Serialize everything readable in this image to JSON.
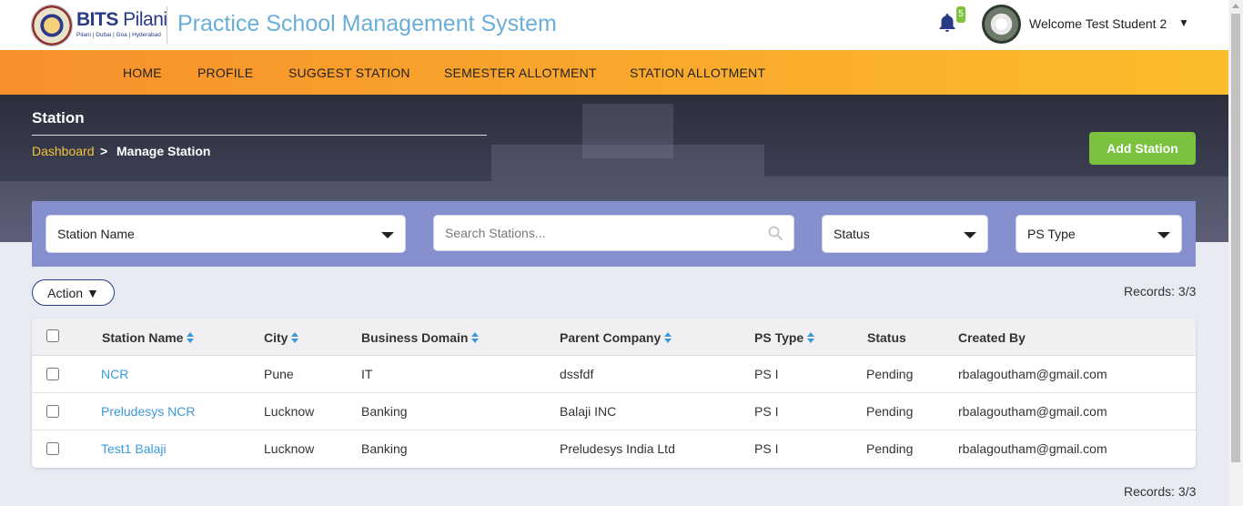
{
  "brand": {
    "name_bold": "BITS",
    "name_light": " Pilani",
    "subtitle": "Pilani | Dubai | Goa | Hyderabad"
  },
  "app_title": "Practice School Management System",
  "notifications": {
    "count": "5"
  },
  "user": {
    "welcome": "Welcome Test Student 2",
    "caret": "▼"
  },
  "nav": {
    "items": [
      "HOME",
      "PROFILE",
      "SUGGEST STATION",
      "SEMESTER ALLOTMENT",
      "STATION ALLOTMENT"
    ]
  },
  "page": {
    "title": "Station",
    "breadcrumb": {
      "link": "Dashboard",
      "separator": ">",
      "current": "Manage Station"
    },
    "add_button": "Add Station"
  },
  "filters": {
    "station_name": "Station Name",
    "search_placeholder": "Search Stations...",
    "status": "Status",
    "ps_type": "PS Type"
  },
  "action_button": "Action ▼",
  "records_label": "Records: 3/3",
  "table": {
    "headers": [
      "Station Name",
      "City",
      "Business Domain",
      "Parent Company",
      "PS Type",
      "Status",
      "Created By"
    ],
    "rows": [
      {
        "station": "NCR",
        "city": "Pune",
        "domain": "IT",
        "company": "dssfdf",
        "ps_type": "PS I",
        "status": "Pending",
        "created_by": "rbalagoutham@gmail.com"
      },
      {
        "station": "Preludesys NCR",
        "city": "Lucknow",
        "domain": "Banking",
        "company": "Balaji INC",
        "ps_type": "PS I",
        "status": "Pending",
        "created_by": "rbalagoutham@gmail.com"
      },
      {
        "station": "Test1 Balaji",
        "city": "Lucknow",
        "domain": "Banking",
        "company": "Preludesys India Ltd",
        "ps_type": "PS I",
        "status": "Pending",
        "created_by": "rbalagoutham@gmail.com"
      }
    ]
  },
  "colors": {
    "accent_orange": "#f7902c",
    "accent_yellow": "#fbbd2c",
    "green": "#7bc23f",
    "filter_bar": "#858fce",
    "link_blue": "#3a9ad9"
  }
}
